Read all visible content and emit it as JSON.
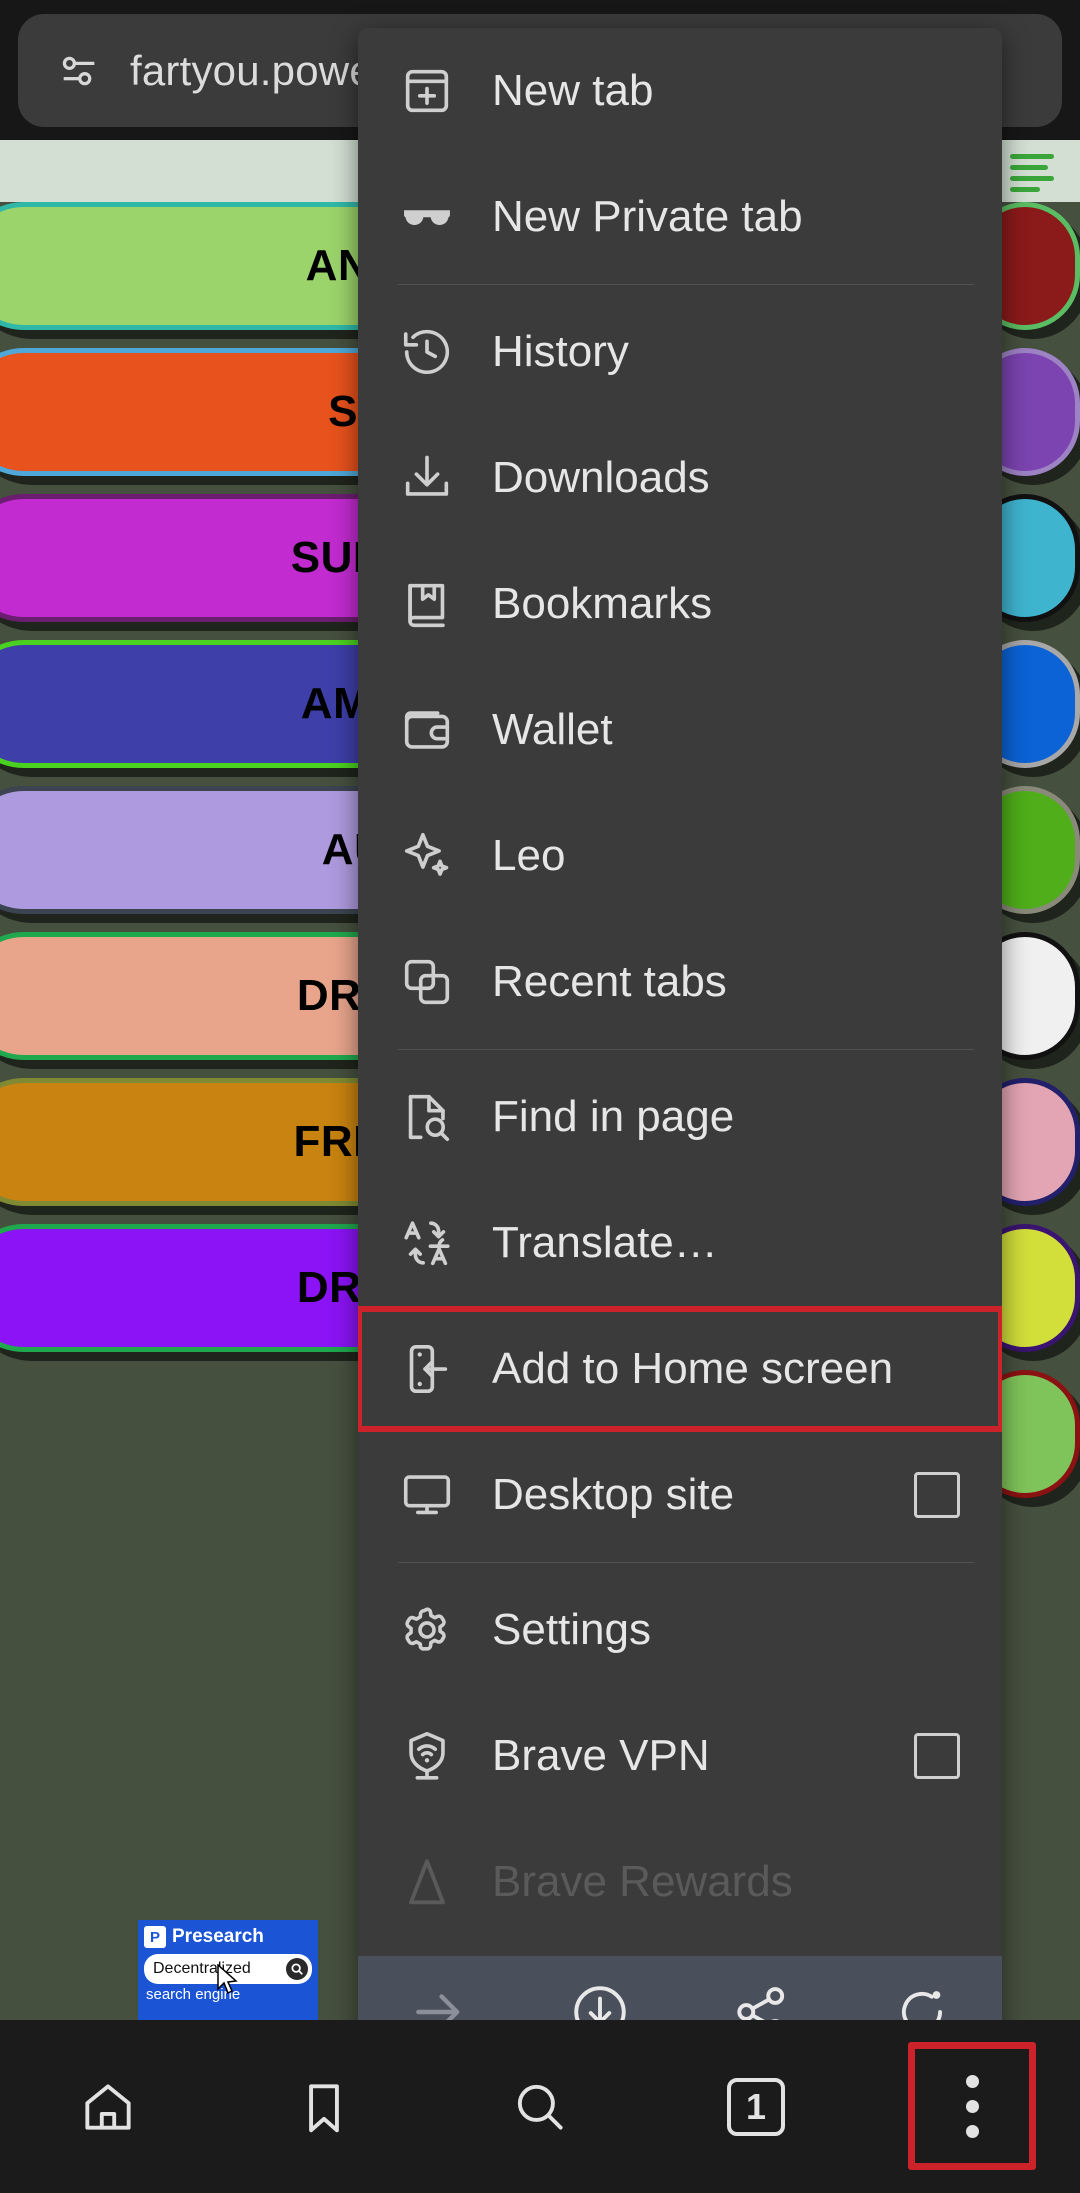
{
  "browser": {
    "url": "fartyou.power",
    "shield_icon": "brave-shield-icon"
  },
  "webpage": {
    "background_color": "#46503f",
    "header_color": "#d2dfd2",
    "menu_icon": "hamburger-menu-icon",
    "pills": [
      {
        "label": "ANCIENT FART",
        "fill": "#9bd46b",
        "border": "#2fb8a8"
      },
      {
        "label": "SUPER FART",
        "fill": "#e8521c",
        "border": "#4fa8d8"
      },
      {
        "label": "SURPRISE FART",
        "fill": "#c22bd0",
        "border": "#6b1d70"
      },
      {
        "label": "AMAZING FART",
        "fill": "#3e3fa8",
        "border": "#4bd120"
      },
      {
        "label": "AUNTIE FART",
        "fill": "#ae9ade",
        "border": "#3b4450"
      },
      {
        "label": "DRIPPING FART",
        "fill": "#e8a58c",
        "border": "#1fa84e"
      },
      {
        "label": "FREEDOM FART",
        "fill": "#c88310",
        "border": "#7f8a33"
      },
      {
        "label": "DRIPPING FART",
        "fill": "#8b13f5",
        "border": "#1fa84e"
      }
    ],
    "edge_pills": [
      {
        "fill": "#8b1a1a",
        "border": "#5bbd63"
      },
      {
        "fill": "#7b44b0",
        "border": "#9d82c4"
      },
      {
        "fill": "#3fb4cf",
        "border": "#111111"
      },
      {
        "fill": "#0b63d6",
        "border": "#a8a8a8"
      },
      {
        "fill": "#4fae1a",
        "border": "#8a8a7a"
      },
      {
        "fill": "#f0f0f0",
        "border": "#111111"
      },
      {
        "fill": "#e3a5b4",
        "border": "#22206b"
      },
      {
        "fill": "#d2de3a",
        "border": "#3a1470"
      },
      {
        "fill": "#7fc45a",
        "border": "#8b1212"
      }
    ],
    "ad": {
      "brand": "Presearch",
      "logo_letter": "P",
      "query": "Decentralized",
      "tagline": "search engine",
      "search_icon": "magnifier-icon",
      "cursor_icon": "mouse-cursor-icon"
    }
  },
  "overflow_menu": {
    "highlight_color": "#cc2229",
    "items": [
      {
        "label": "New tab",
        "icon": "new-tab-icon",
        "name": "new-tab"
      },
      {
        "label": "New Private tab",
        "icon": "glasses-icon",
        "name": "new-private-tab"
      },
      {
        "divider_after": true
      },
      {
        "label": "History",
        "icon": "history-clock-icon",
        "name": "history"
      },
      {
        "label": "Downloads",
        "icon": "download-icon",
        "name": "downloads"
      },
      {
        "label": "Bookmarks",
        "icon": "bookmark-book-icon",
        "name": "bookmarks"
      },
      {
        "label": "Wallet",
        "icon": "wallet-icon",
        "name": "wallet"
      },
      {
        "label": "Leo",
        "icon": "sparkle-icon",
        "name": "leo"
      },
      {
        "label": "Recent tabs",
        "icon": "recent-tabs-icon",
        "name": "recent-tabs"
      },
      {
        "divider_after": true
      },
      {
        "label": "Find in page",
        "icon": "find-in-page-icon",
        "name": "find-in-page"
      },
      {
        "label": "Translate…",
        "icon": "translate-icon",
        "name": "translate"
      },
      {
        "label": "Add to Home screen",
        "icon": "add-to-home-icon",
        "name": "add-to-home-screen",
        "highlighted": true
      },
      {
        "label": "Desktop site",
        "icon": "desktop-monitor-icon",
        "name": "desktop-site",
        "checkbox": true,
        "checked": false
      },
      {
        "divider_after": true
      },
      {
        "label": "Settings",
        "icon": "gear-icon",
        "name": "settings"
      },
      {
        "label": "Brave VPN",
        "icon": "vpn-shield-icon",
        "name": "brave-vpn",
        "checkbox": true,
        "checked": false
      },
      {
        "label": "Brave Rewards",
        "icon": "brave-lion-icon",
        "name": "brave-rewards",
        "dim": true
      }
    ],
    "actions": [
      {
        "icon": "forward-arrow-icon",
        "name": "forward-button",
        "disabled": true
      },
      {
        "icon": "download-circle-icon",
        "name": "download-page-button"
      },
      {
        "icon": "share-icon",
        "name": "share-button"
      },
      {
        "icon": "reload-icon",
        "name": "reload-button"
      }
    ]
  },
  "bottom_nav": {
    "items": [
      {
        "icon": "home-icon",
        "name": "home-button"
      },
      {
        "icon": "bookmark-icon",
        "name": "bookmarks-button"
      },
      {
        "icon": "search-icon",
        "name": "search-button"
      },
      {
        "icon": "tab-count-icon",
        "name": "tab-switcher-button",
        "count": "1"
      },
      {
        "icon": "three-dots-icon",
        "name": "overflow-menu-button",
        "highlighted": true
      }
    ]
  }
}
